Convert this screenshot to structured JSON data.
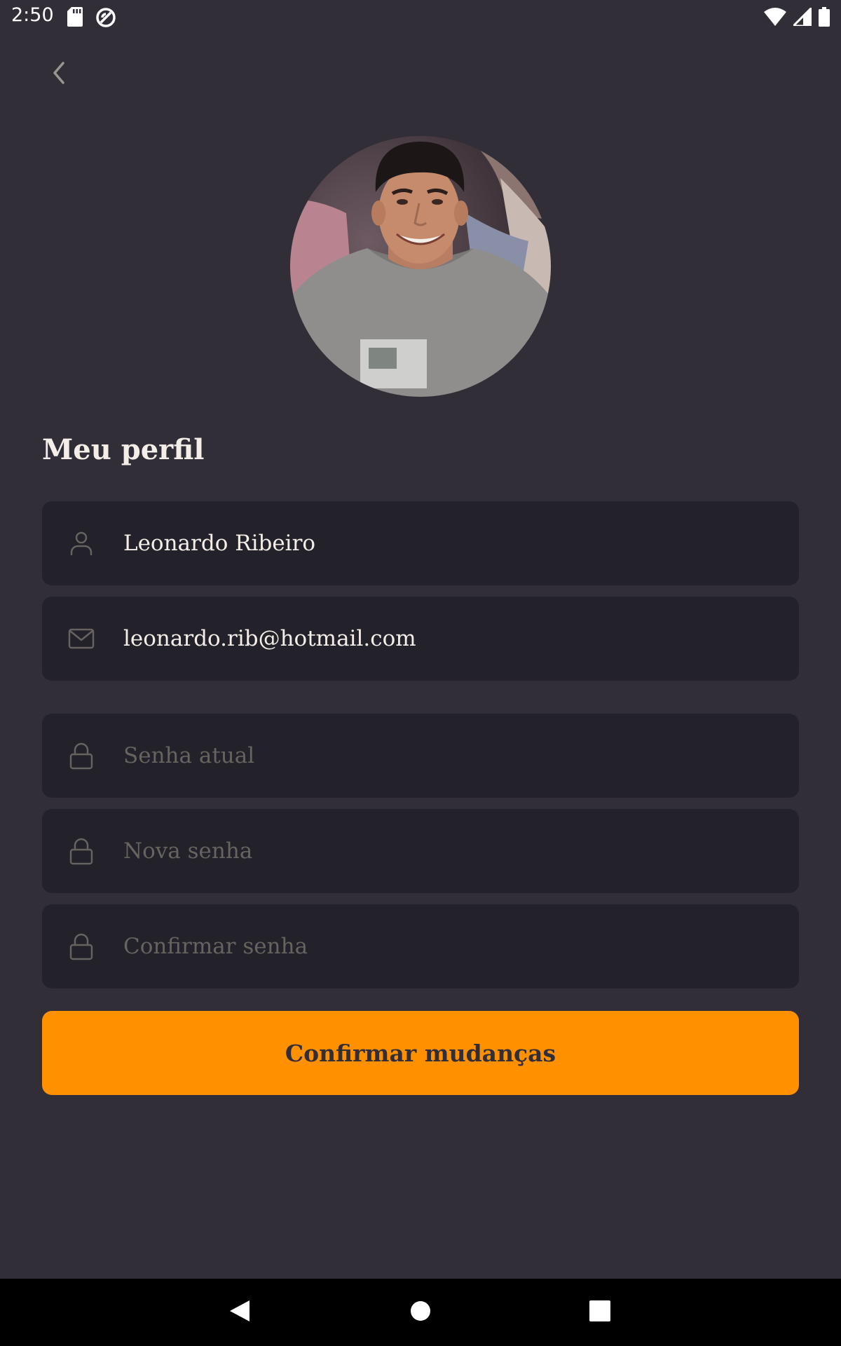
{
  "status_bar": {
    "time": "2:50",
    "icons": [
      "sd-card-icon",
      "data-saver-icon",
      "wifi-icon",
      "cell-signal-icon",
      "battery-icon"
    ]
  },
  "header": {
    "back_icon": "chevron-left-icon"
  },
  "profile": {
    "title": "Meu perfil"
  },
  "form": {
    "name_value": "Leonardo Ribeiro",
    "email_value": "leonardo.rib@hotmail.com",
    "current_password_placeholder": "Senha atual",
    "new_password_placeholder": "Nova senha",
    "confirm_password_placeholder": "Confirmar senha",
    "submit_label": "Confirmar mudanças"
  },
  "colors": {
    "background": "#312e38",
    "input_background": "#232129",
    "accent": "#ff9000",
    "text": "#f4ede8",
    "placeholder": "#666360",
    "icon": "#666360"
  },
  "nav_bar": {
    "icons": [
      "nav-back-icon",
      "nav-home-icon",
      "nav-recents-icon"
    ]
  }
}
